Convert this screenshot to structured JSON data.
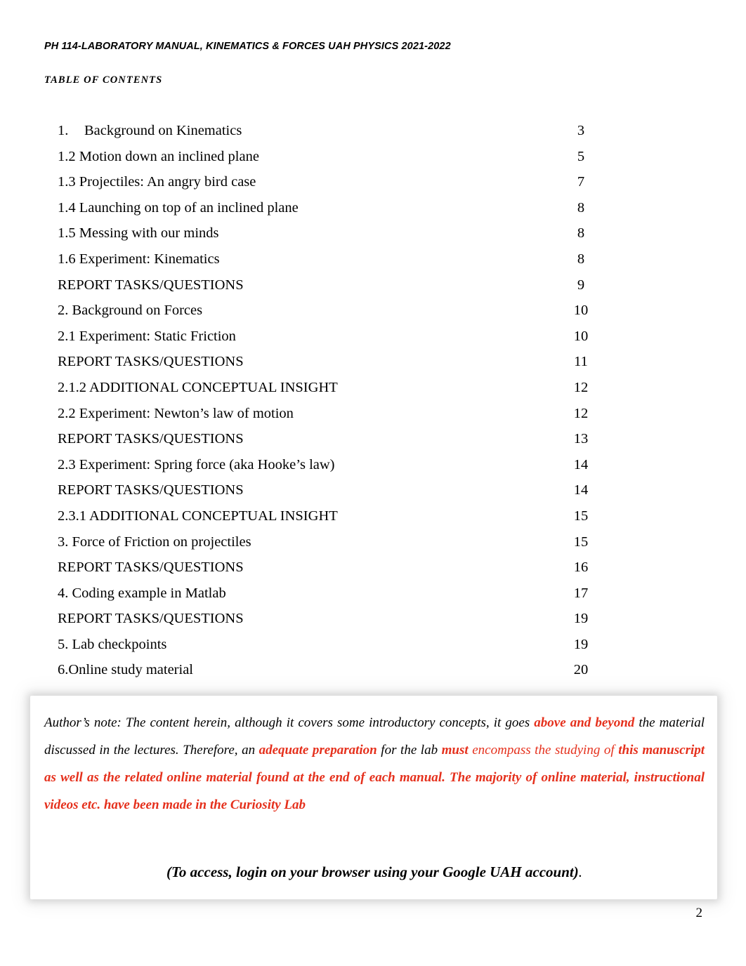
{
  "document": {
    "running_header": "PH 114-LABORATORY MANUAL, KINEMATICS & FORCES UAH PHYSICS 2021-2022",
    "section_heading": "TABLE OF CONTENTS",
    "page_number": "2"
  },
  "toc": {
    "entries": [
      {
        "number": "1.",
        "title": "Background on Kinematics",
        "page": "3",
        "tabbed": true
      },
      {
        "number": "",
        "title": "1.2 Motion down an inclined plane",
        "page": "5",
        "tabbed": false
      },
      {
        "number": "",
        "title": "1.3 Projectiles: An angry bird case",
        "page": "7",
        "tabbed": false
      },
      {
        "number": "",
        "title": "1.4 Launching on top of an inclined plane",
        "page": "8",
        "tabbed": false
      },
      {
        "number": "",
        "title": "1.5 Messing with our minds",
        "page": "8",
        "tabbed": false
      },
      {
        "number": "",
        "title": "1.6 Experiment: Kinematics",
        "page": "8",
        "tabbed": false
      },
      {
        "number": "",
        "title": "REPORT TASKS/QUESTIONS",
        "page": "9",
        "tabbed": false
      },
      {
        "number": "",
        "title": "2. Background on Forces",
        "page": "10",
        "tabbed": false
      },
      {
        "number": "",
        "title": "2.1 Experiment: Static Friction",
        "page": "10",
        "tabbed": false
      },
      {
        "number": "",
        "title": "REPORT TASKS/QUESTIONS",
        "page": "11",
        "tabbed": false
      },
      {
        "number": "",
        "title": "2.1.2 ADDITIONAL CONCEPTUAL INSIGHT",
        "page": "12",
        "tabbed": false
      },
      {
        "number": "",
        "title": "2.2 Experiment: Newton’s law of motion",
        "page": "12",
        "tabbed": false
      },
      {
        "number": "",
        "title": "REPORT TASKS/QUESTIONS",
        "page": "13",
        "tabbed": false
      },
      {
        "number": "",
        "title": "2.3 Experiment: Spring force (aka Hooke’s law)",
        "page": "14",
        "tabbed": false
      },
      {
        "number": "",
        "title": "REPORT TASKS/QUESTIONS",
        "page": "14",
        "tabbed": false
      },
      {
        "number": "",
        "title": "2.3.1 ADDITIONAL CONCEPTUAL INSIGHT",
        "page": "15",
        "tabbed": false
      },
      {
        "number": "",
        "title": "3. Force of Friction on projectiles",
        "page": "15",
        "tabbed": false
      },
      {
        "number": "",
        "title": "REPORT TASKS/QUESTIONS",
        "page": "16",
        "tabbed": false
      },
      {
        "number": "",
        "title": "4. Coding example in Matlab",
        "page": "17",
        "tabbed": false
      },
      {
        "number": "",
        "title": "REPORT TASKS/QUESTIONS",
        "page": "19",
        "tabbed": false
      },
      {
        "number": "",
        "title": "5. Lab checkpoints",
        "page": "19",
        "tabbed": false
      },
      {
        "number": "",
        "title": "6.Online study material",
        "page": "20",
        "tabbed": false
      }
    ]
  },
  "author_note": {
    "segments": [
      {
        "text": "Author’s note: The content herein, although it covers some introductory concepts, it goes ",
        "style": "plain"
      },
      {
        "text": "above and beyond",
        "style": "highlight"
      },
      {
        "text": " the material discussed in the lectures. Therefore, an ",
        "style": "plain"
      },
      {
        "text": "adequate preparation",
        "style": "highlight"
      },
      {
        "text": " for the lab ",
        "style": "plain"
      },
      {
        "text": "must",
        "style": "highlight"
      },
      {
        "text": " ",
        "style": "plain"
      },
      {
        "text": "encompass the studying of",
        "style": "highlight-light"
      },
      {
        "text": " ",
        "style": "plain"
      },
      {
        "text": "this manuscript as well as the related online material found at the end of each manual. The majority of online material, instructional videos etc. have been made in the Curiosity Lab",
        "style": "highlight"
      }
    ],
    "access_line": "(To access, login on your browser using your Google UAH account)",
    "access_period": ".",
    "accent_color": "#e5301c"
  }
}
